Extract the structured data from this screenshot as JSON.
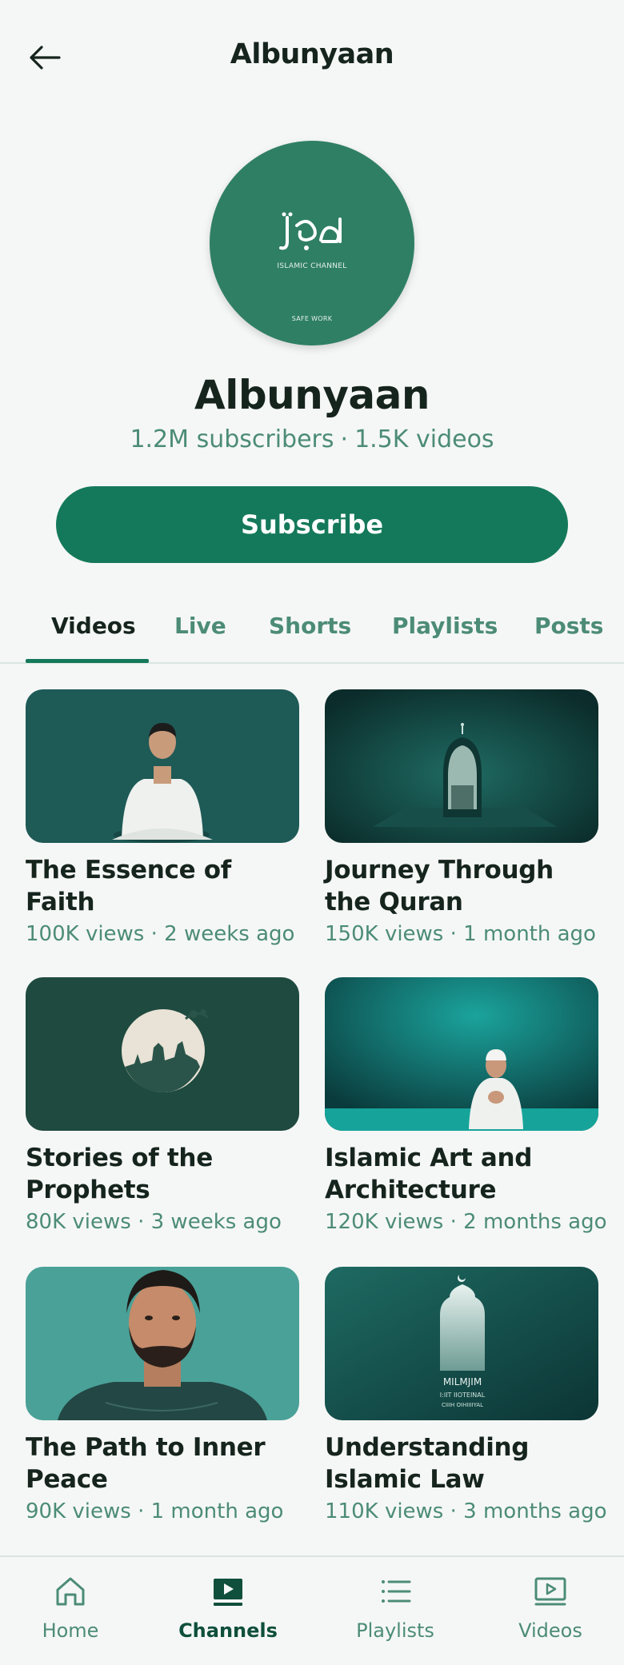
{
  "header": {
    "title": "Albunyaan",
    "back_icon": "arrow-left-icon"
  },
  "channel": {
    "avatar_logo_text": "جهد",
    "avatar_sub_text": "ISLAMIC CHANNEL",
    "avatar_foot_text": "SAFE WORK",
    "name": "Albunyaan",
    "subscribers": "1.2M subscribers",
    "separator": "·",
    "videos_count": "1.5K videos",
    "subscribe_label": "Subscribe",
    "accent_color": "#14795a"
  },
  "tabs": [
    {
      "label": "Videos",
      "active": true
    },
    {
      "label": "Live",
      "active": false
    },
    {
      "label": "Shorts",
      "active": false
    },
    {
      "label": "Playlists",
      "active": false
    },
    {
      "label": "Posts",
      "active": false
    }
  ],
  "videos": [
    {
      "title": "The Essence of Faith",
      "views": "100K views",
      "age": "2 weeks ago"
    },
    {
      "title": "Journey Through the Quran",
      "views": "150K views",
      "age": "1 month ago"
    },
    {
      "title": "Stories of the Prophets",
      "views": "80K views",
      "age": "3 weeks ago"
    },
    {
      "title": "Islamic Art and Architecture",
      "views": "120K views",
      "age": "2 months ago"
    },
    {
      "title": "The Path to Inner Peace",
      "views": "90K views",
      "age": "1 month ago"
    },
    {
      "title": "Understanding Islamic Law",
      "views": "110K views",
      "age": "3 months ago",
      "thumb_text_1": "MILMJIM",
      "thumb_text_2": "I:IIT IIOTEINAL",
      "thumb_text_3": "CIIIH OIHIIIIYAL"
    }
  ],
  "bottom_nav": [
    {
      "label": "Home",
      "icon": "home-icon",
      "active": false
    },
    {
      "label": "Channels",
      "icon": "channels-icon",
      "active": true
    },
    {
      "label": "Playlists",
      "icon": "playlists-icon",
      "active": false
    },
    {
      "label": "Videos",
      "icon": "videos-icon",
      "active": false
    }
  ]
}
